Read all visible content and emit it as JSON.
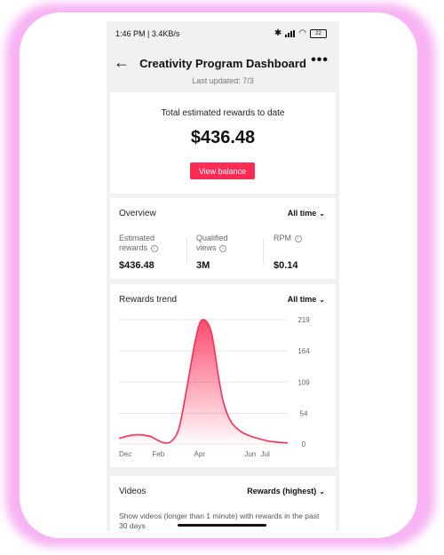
{
  "status_bar": {
    "time": "1:46 PM | 3.4KB/s",
    "battery": "22"
  },
  "header": {
    "title": "Creativity Program Dashboard"
  },
  "last_updated": "Last updated: 7/3",
  "summary": {
    "label": "Total estimated rewards to date",
    "value": "$436.48",
    "button": "View balance"
  },
  "overview": {
    "title": "Overview",
    "filter": "All time",
    "metrics": [
      {
        "label_line1": "Estimated",
        "label_line2": "rewards",
        "value": "$436.48"
      },
      {
        "label_line1": "Qualified",
        "label_line2": "views",
        "value": "3M"
      },
      {
        "label_line1": "RPM",
        "label_line2": "",
        "value": "$0.14"
      }
    ]
  },
  "trend": {
    "title": "Rewards trend",
    "filter": "All time"
  },
  "chart_data": {
    "type": "area",
    "x_labels": [
      "Dec",
      "Feb",
      "Apr",
      "Jun",
      "Jul"
    ],
    "y_ticks": [
      0,
      54,
      109,
      164,
      219
    ],
    "ylim": [
      0,
      219
    ],
    "x_range": [
      0,
      9
    ],
    "series": [
      {
        "x": [
          0,
          0.8,
          1.6,
          2.1,
          2.4,
          2.8,
          3.2,
          3.6,
          4.0,
          4.3,
          4.6,
          4.9,
          5.1,
          5.3,
          5.6,
          6.0,
          6.5,
          7.0,
          7.5,
          8.0,
          8.5,
          9.0
        ],
        "values": [
          10,
          16,
          14,
          6,
          2,
          5,
          28,
          95,
          170,
          212,
          218,
          200,
          165,
          120,
          70,
          38,
          22,
          14,
          9,
          5,
          3,
          2
        ]
      }
    ],
    "line_color": "#fe2c55",
    "grid": true
  },
  "videos": {
    "title": "Videos",
    "sort": "Rewards (highest)",
    "description": "Show videos (longer than 1 minute) with rewards in the past 30 days"
  },
  "colors": {
    "accent": "#fe2c55",
    "glow": "#f7b3f3"
  }
}
